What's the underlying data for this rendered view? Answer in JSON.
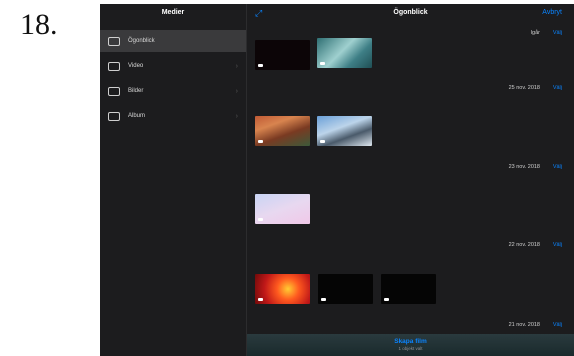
{
  "step_number": "18.",
  "sidebar": {
    "title": "Medier",
    "items": [
      {
        "label": "Ögonblick",
        "icon": "moments-icon",
        "selected": true,
        "chevron": false
      },
      {
        "label": "Video",
        "icon": "video-icon",
        "selected": false,
        "chevron": true
      },
      {
        "label": "Bilder",
        "icon": "photos-icon",
        "selected": false,
        "chevron": true
      },
      {
        "label": "Album",
        "icon": "album-icon",
        "selected": false,
        "chevron": true
      }
    ]
  },
  "main": {
    "title": "Ögonblick",
    "cancel_label": "Avbryt",
    "expand_icon": "expand-icon",
    "sections": [
      {
        "date": "Igår",
        "select_label": "Välj"
      },
      {
        "date": "25 nov. 2018",
        "select_label": "Välj"
      },
      {
        "date": "23 nov. 2018",
        "select_label": "Välj"
      },
      {
        "date": "22 nov. 2018",
        "select_label": "Välj"
      },
      {
        "date": "21 nov. 2018",
        "select_label": "Välj"
      }
    ],
    "create_movie_label": "Skapa film",
    "create_movie_sub": "1 objekt valt"
  },
  "colors": {
    "accent": "#0a84ff",
    "background": "#1c1c1e",
    "selected_row": "#3a3a3c"
  }
}
